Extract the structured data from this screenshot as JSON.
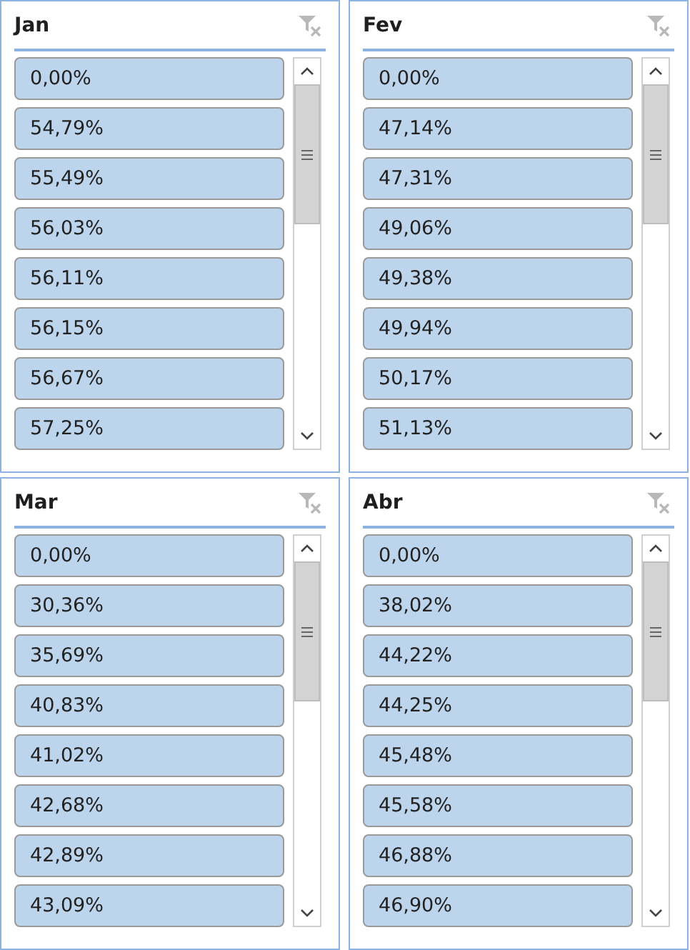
{
  "slicers": [
    {
      "title": "Jan",
      "items": [
        {
          "label": "0,00%",
          "selected": true
        },
        {
          "label": "54,79%",
          "selected": true
        },
        {
          "label": "55,49%",
          "selected": true
        },
        {
          "label": "56,03%",
          "selected": true
        },
        {
          "label": "56,11%",
          "selected": true
        },
        {
          "label": "56,15%",
          "selected": true
        },
        {
          "label": "56,67%",
          "selected": true
        },
        {
          "label": "57,25%",
          "selected": true
        }
      ]
    },
    {
      "title": "Fev",
      "items": [
        {
          "label": "0,00%",
          "selected": true
        },
        {
          "label": "47,14%",
          "selected": true
        },
        {
          "label": "47,31%",
          "selected": true
        },
        {
          "label": "49,06%",
          "selected": true
        },
        {
          "label": "49,38%",
          "selected": true
        },
        {
          "label": "49,94%",
          "selected": true
        },
        {
          "label": "50,17%",
          "selected": true
        },
        {
          "label": "51,13%",
          "selected": true
        }
      ]
    },
    {
      "title": "Mar",
      "items": [
        {
          "label": "0,00%",
          "selected": true
        },
        {
          "label": "30,36%",
          "selected": true
        },
        {
          "label": "35,69%",
          "selected": true
        },
        {
          "label": "40,83%",
          "selected": true
        },
        {
          "label": "41,02%",
          "selected": true
        },
        {
          "label": "42,68%",
          "selected": true
        },
        {
          "label": "42,89%",
          "selected": true
        },
        {
          "label": "43,09%",
          "selected": true
        }
      ]
    },
    {
      "title": "Abr",
      "items": [
        {
          "label": "0,00%",
          "selected": true
        },
        {
          "label": "38,02%",
          "selected": true
        },
        {
          "label": "44,22%",
          "selected": true
        },
        {
          "label": "44,25%",
          "selected": true
        },
        {
          "label": "45,48%",
          "selected": true
        },
        {
          "label": "45,58%",
          "selected": true
        },
        {
          "label": "46,88%",
          "selected": true
        },
        {
          "label": "46,90%",
          "selected": true
        }
      ]
    }
  ]
}
